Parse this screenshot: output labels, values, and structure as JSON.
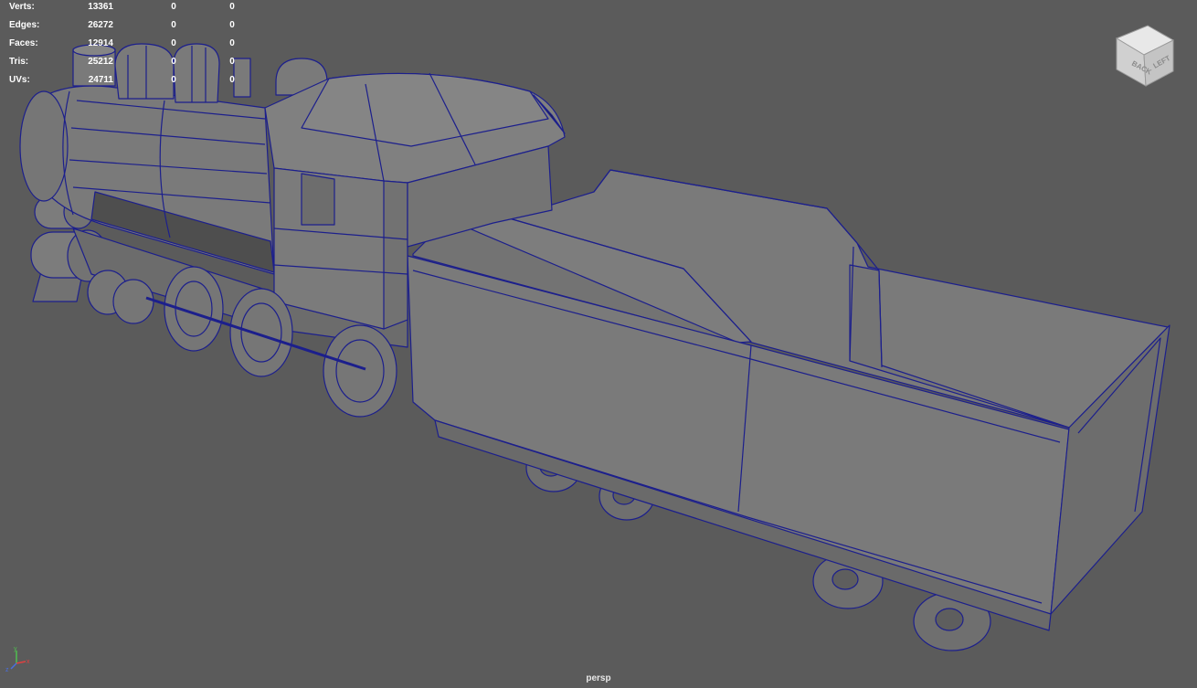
{
  "heads_up_display": {
    "rows": [
      {
        "label": "Verts:",
        "total": "13361",
        "selected": "0",
        "component": "0"
      },
      {
        "label": "Edges:",
        "total": "26272",
        "selected": "0",
        "component": "0"
      },
      {
        "label": "Faces:",
        "total": "12914",
        "selected": "0",
        "component": "0"
      },
      {
        "label": "Tris:",
        "total": "25212",
        "selected": "0",
        "component": "0"
      },
      {
        "label": "UVs:",
        "total": "24711",
        "selected": "0",
        "component": "0"
      }
    ]
  },
  "viewcube": {
    "face_back": "BACK",
    "face_left": "LEFT"
  },
  "axis_gizmo": {
    "x": "x",
    "y": "y",
    "z": "z"
  },
  "camera": {
    "name": "persp"
  },
  "colors": {
    "viewport_bg": "#5b5b5b",
    "wire": "#1c1f8c",
    "surface": "#7a7a7a",
    "surface_dark": "#6a6a6a"
  }
}
